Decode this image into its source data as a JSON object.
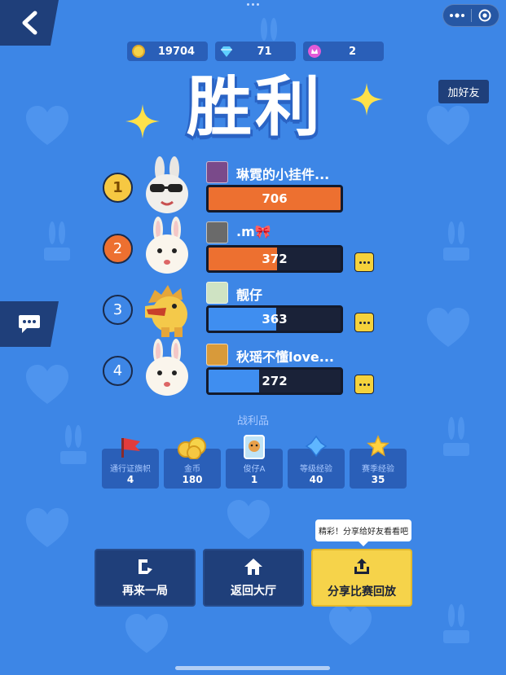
{
  "resources": [
    {
      "icon": "coin-icon",
      "value": "19704",
      "color": "#f6d34a"
    },
    {
      "icon": "diamond-icon",
      "value": "71",
      "color": "#5fd0ff"
    },
    {
      "icon": "flower-icon",
      "value": "2",
      "color": "#e25bd8"
    }
  ],
  "add_friend_label": "加好友",
  "victory_text": "胜利",
  "players": [
    {
      "rank": "1",
      "name": "琳霓的小挂件...",
      "score": "706",
      "fill": 1.0,
      "bar_color": "#ed7030",
      "badge_color": "#f6c842",
      "has_more": false,
      "avatar": "rabbit-sunglasses"
    },
    {
      "rank": "2",
      "name": ".m🎀",
      "score": "372",
      "fill": 0.52,
      "bar_color": "#ed7030",
      "badge_color": "#ed7030",
      "has_more": true,
      "avatar": "rabbit"
    },
    {
      "rank": "3",
      "name": "靓仔",
      "score": "363",
      "fill": 0.51,
      "bar_color": "#3f8ef0",
      "badge_color": "#3d86e6",
      "has_more": true,
      "avatar": "dinosaur"
    },
    {
      "rank": "4",
      "name": "秋瑶不懂love...",
      "score": "272",
      "fill": 0.38,
      "bar_color": "#3f8ef0",
      "badge_color": "#3d86e6",
      "has_more": true,
      "avatar": "rabbit"
    }
  ],
  "loot_title": "战利品",
  "loot": [
    {
      "label": "通行证旗帜",
      "count": "4",
      "icon": "flag-icon"
    },
    {
      "label": "金币",
      "count": "180",
      "icon": "coins-icon"
    },
    {
      "label": "俊仔A",
      "count": "1",
      "icon": "dog-card-icon"
    },
    {
      "label": "等级经验",
      "count": "40",
      "icon": "blue-star-icon"
    },
    {
      "label": "赛季经验",
      "count": "35",
      "icon": "gold-star-icon"
    }
  ],
  "buttons": {
    "again": "再来一局",
    "lobby": "返回大厅",
    "share": "分享比赛回放"
  },
  "tooltip": "精彩！分享给好友看看吧"
}
